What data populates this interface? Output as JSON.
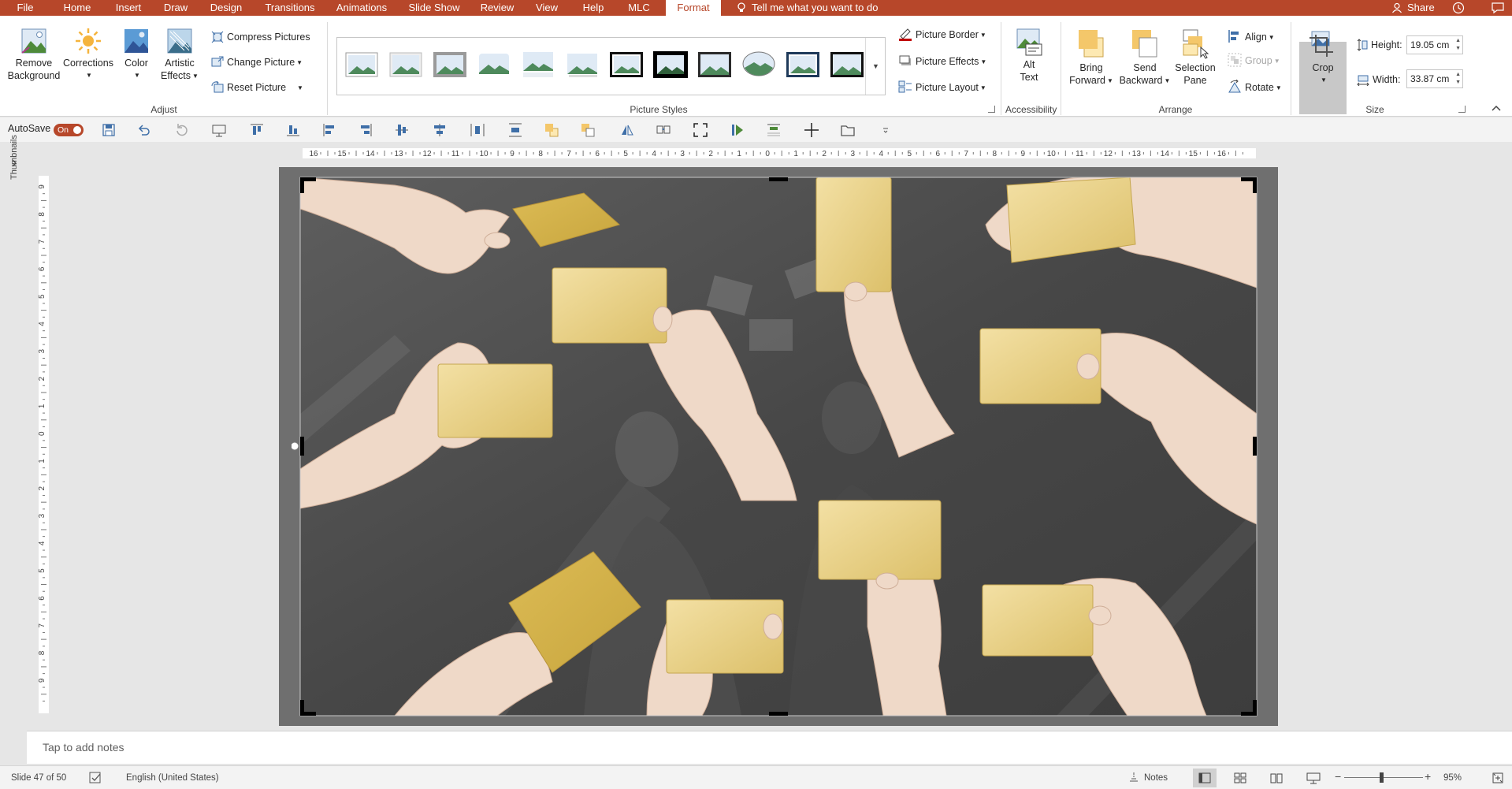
{
  "tabs": [
    {
      "label": "File",
      "active": false
    },
    {
      "label": "Home",
      "active": false
    },
    {
      "label": "Insert",
      "active": false
    },
    {
      "label": "Draw",
      "active": false
    },
    {
      "label": "Design",
      "active": false
    },
    {
      "label": "Transitions",
      "active": false
    },
    {
      "label": "Animations",
      "active": false
    },
    {
      "label": "Slide Show",
      "active": false
    },
    {
      "label": "Review",
      "active": false
    },
    {
      "label": "View",
      "active": false
    },
    {
      "label": "Help",
      "active": false
    },
    {
      "label": "MLC",
      "active": false
    },
    {
      "label": "Format",
      "active": true
    }
  ],
  "tell_me": "Tell me what you want to do",
  "share": "Share",
  "ribbon": {
    "adjust": {
      "remove_background": [
        "Remove",
        "Background"
      ],
      "corrections": "Corrections",
      "color": "Color",
      "artistic_effects": [
        "Artistic",
        "Effects"
      ],
      "compress": "Compress Pictures",
      "change": "Change Picture",
      "reset": "Reset Picture",
      "label": "Adjust"
    },
    "styles": {
      "label": "Picture Styles",
      "border": "Picture Border",
      "effects": "Picture Effects",
      "layout": "Picture Layout"
    },
    "accessibility": {
      "alt_text": [
        "Alt",
        "Text"
      ],
      "label": "Accessibility"
    },
    "arrange": {
      "bring_forward": [
        "Bring",
        "Forward"
      ],
      "send_backward": [
        "Send",
        "Backward"
      ],
      "selection_pane": [
        "Selection",
        "Pane"
      ],
      "align": "Align",
      "group": "Group",
      "rotate": "Rotate",
      "label": "Arrange"
    },
    "size": {
      "crop": "Crop",
      "height_label": "Height:",
      "height_value": "19.05 cm",
      "width_label": "Width:",
      "width_value": "33.87 cm",
      "label": "Size"
    }
  },
  "qat": {
    "autosave": "AutoSave",
    "toggle": "On"
  },
  "thumbnails_label": "Thumbnails",
  "ruler_h": [
    "16",
    "15",
    "14",
    "13",
    "12",
    "11",
    "10",
    "9",
    "8",
    "7",
    "6",
    "5",
    "4",
    "3",
    "2",
    "1",
    "0",
    "1",
    "2",
    "3",
    "4",
    "5",
    "6",
    "7",
    "8",
    "9",
    "10",
    "11",
    "12",
    "13",
    "14",
    "15",
    "16"
  ],
  "ruler_v": [
    "9",
    "8",
    "7",
    "6",
    "5",
    "4",
    "3",
    "2",
    "1",
    "0",
    "1",
    "2",
    "3",
    "4",
    "5",
    "6",
    "7",
    "8",
    "9"
  ],
  "notes_placeholder": "Tap to add notes",
  "status": {
    "slide": "Slide 47 of 50",
    "language": "English (United States)",
    "notes": "Notes",
    "zoom": "95%"
  },
  "colors": {
    "accent": "#b7472a",
    "card": "#e4c86a",
    "card_light": "#f0dc96",
    "skin": "#f1dccd"
  }
}
